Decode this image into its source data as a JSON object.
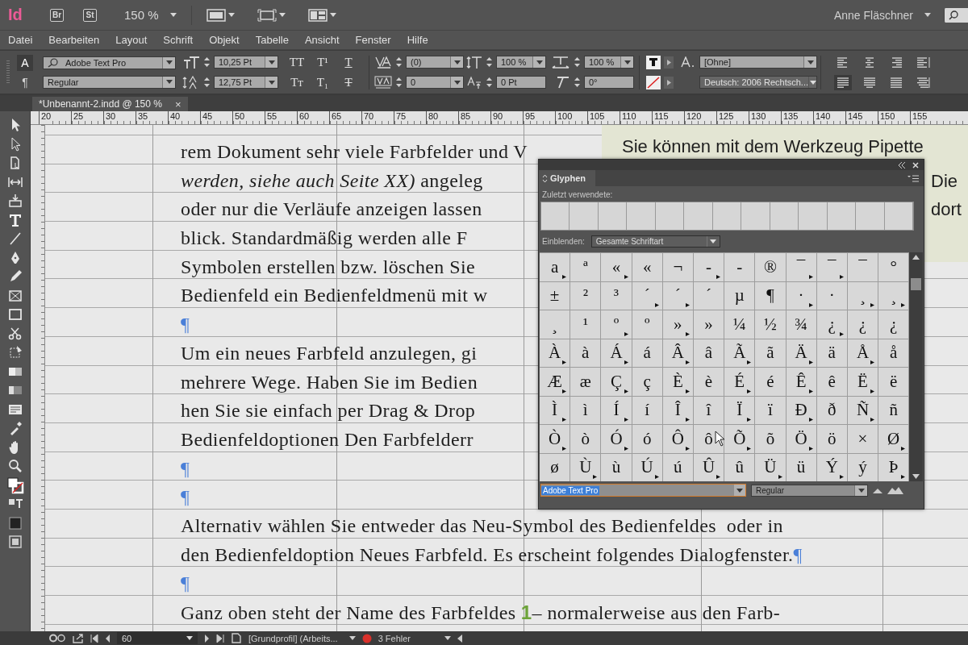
{
  "app_bar": {
    "logo": "Id",
    "bridge": "Br",
    "stock": "St",
    "zoom": "150 %",
    "user": "Anne Fläschner"
  },
  "menu": [
    "Datei",
    "Bearbeiten",
    "Layout",
    "Schrift",
    "Objekt",
    "Tabelle",
    "Ansicht",
    "Fenster",
    "Hilfe"
  ],
  "control_panel": {
    "modes": [
      {
        "label": "A",
        "selected": true
      },
      {
        "label": "¶",
        "selected": false
      }
    ],
    "font_family": "Adobe Text Pro",
    "font_style": "Regular",
    "font_size": "10,25 Pt",
    "leading": "12,75 Pt",
    "format_buttons": [
      {
        "label": "TT",
        "kind": "plain"
      },
      {
        "label": "T¹",
        "kind": "plain"
      },
      {
        "label": "T",
        "kind": "underline"
      },
      {
        "label": "Tт",
        "kind": "plain"
      },
      {
        "label": "T₁",
        "kind": "plain"
      },
      {
        "label": "T",
        "kind": "strike"
      }
    ],
    "kerning": "(0)",
    "tracking": "0",
    "vertical_scale": "100 %",
    "baseline_shift": "0 Pt",
    "horizontal_scale": "100 %",
    "skew": "0°",
    "char_style": "[Ohne]",
    "language": "Deutsch: 2006 Rechtsch...",
    "alignments": [
      {
        "kind": "left",
        "selected": false
      },
      {
        "kind": "center",
        "selected": false
      },
      {
        "kind": "right",
        "selected": false
      },
      {
        "kind": "spine",
        "selected": false
      },
      {
        "kind": "justify",
        "selected": true
      },
      {
        "kind": "justify-center",
        "selected": false
      },
      {
        "kind": "justify-all",
        "selected": false
      },
      {
        "kind": "spine-away",
        "selected": false
      }
    ]
  },
  "document_tab": {
    "title": "*Unbenannt-2.indd @ 150 %",
    "close": "×"
  },
  "ruler": [
    "20",
    "25",
    "30",
    "35",
    "40",
    "45",
    "50",
    "55",
    "60",
    "65",
    "70",
    "75",
    "80",
    "85",
    "90",
    "95",
    "100",
    "105",
    "110",
    "115",
    "120",
    "125",
    "130",
    "135",
    "140",
    "145",
    "150",
    "155"
  ],
  "document": {
    "lines": [
      [
        {
          "kind": "plain",
          "text": "rem Dokument sehr viele Farbfelder und V"
        }
      ],
      [
        {
          "kind": "italic",
          "text": "werden, siehe auch Seite XX)"
        },
        {
          "kind": "plain",
          "text": " angeleg"
        }
      ],
      [
        {
          "kind": "plain",
          "text": "oder nur die Verläufe anzeigen lassen"
        }
      ],
      [
        {
          "kind": "plain",
          "text": "blick. Standardmäßig werden alle F"
        }
      ],
      [
        {
          "kind": "plain",
          "text": "Symbolen erstellen bzw. löschen Sie"
        }
      ],
      [
        {
          "kind": "plain",
          "text": "Bedienfeld ein Bedienfeldmenü mit w"
        }
      ],
      [
        {
          "kind": "pilcrow",
          "text": "¶"
        }
      ],
      [
        {
          "kind": "plain",
          "text": "Um ein neues Farbfeld anzulegen, gi"
        }
      ],
      [
        {
          "kind": "plain",
          "text": "mehrere Wege. Haben Sie im Bedien"
        }
      ],
      [
        {
          "kind": "plain",
          "text": "hen Sie sie einfach per Drag & Drop"
        }
      ],
      [
        {
          "kind": "plain",
          "text": "Bedienfeldoptionen Den Farbfelderr"
        }
      ],
      [
        {
          "kind": "pilcrow",
          "text": "¶"
        }
      ],
      [
        {
          "kind": "pilcrow",
          "text": "¶"
        }
      ],
      [
        {
          "kind": "plain",
          "text": "Alternativ wählen Sie entweder das Neu-Symbol des Bedienfeldes  oder in"
        }
      ],
      [
        {
          "kind": "plain",
          "text": "den Bedienfeldoption Neues Farbfeld. Es erscheint folgendes Dialogfenster."
        },
        {
          "kind": "pilcrow",
          "text": "¶"
        }
      ],
      [
        {
          "kind": "pilcrow",
          "text": "¶"
        }
      ],
      [
        {
          "kind": "plain",
          "text": "Ganz oben steht der Name des Farbfeldes "
        },
        {
          "kind": "marker",
          "text": "1"
        },
        {
          "kind": "plain",
          "text": "– normalerweise aus den Farb-"
        }
      ]
    ],
    "tip_frame": {
      "first_line": "Sie können mit dem Werkzeug Pipette",
      "side_lines": [
        "Die",
        "dort"
      ]
    }
  },
  "glyph_panel": {
    "title": "Glyphen",
    "recent_label": "Zuletzt verwendete:",
    "show_label": "Einblenden:",
    "show_value": "Gesamte Schriftart",
    "font": "Adobe Text Pro",
    "style": "Regular",
    "rows": [
      [
        {
          "glyph": "a",
          "alternates": true
        },
        {
          "glyph": "ª",
          "alternates": false
        },
        {
          "glyph": "«",
          "alternates": true
        },
        {
          "glyph": "«",
          "alternates": false
        },
        {
          "glyph": "¬",
          "alternates": false
        },
        {
          "glyph": "-",
          "alternates": true
        },
        {
          "glyph": "-",
          "alternates": false
        },
        {
          "glyph": "®",
          "alternates": false
        },
        {
          "glyph": "¯",
          "alternates": true
        },
        {
          "glyph": "¯",
          "alternates": true
        },
        {
          "glyph": "¯",
          "alternates": false
        },
        {
          "glyph": "°",
          "alternates": false
        }
      ],
      [
        {
          "glyph": "±",
          "alternates": false
        },
        {
          "glyph": "²",
          "alternates": false
        },
        {
          "glyph": "³",
          "alternates": false
        },
        {
          "glyph": "´",
          "alternates": true
        },
        {
          "glyph": "´",
          "alternates": true
        },
        {
          "glyph": "´",
          "alternates": false
        },
        {
          "glyph": "µ",
          "alternates": false
        },
        {
          "glyph": "¶",
          "alternates": false
        },
        {
          "glyph": "·",
          "alternates": true
        },
        {
          "glyph": "·",
          "alternates": false
        },
        {
          "glyph": "¸",
          "alternates": true
        },
        {
          "glyph": "¸",
          "alternates": true
        }
      ],
      [
        {
          "glyph": "¸",
          "alternates": false
        },
        {
          "glyph": "¹",
          "alternates": false
        },
        {
          "glyph": "º",
          "alternates": true
        },
        {
          "glyph": "º",
          "alternates": false
        },
        {
          "glyph": "»",
          "alternates": true
        },
        {
          "glyph": "»",
          "alternates": false
        },
        {
          "glyph": "¼",
          "alternates": false
        },
        {
          "glyph": "½",
          "alternates": false
        },
        {
          "glyph": "¾",
          "alternates": false
        },
        {
          "glyph": "¿",
          "alternates": true
        },
        {
          "glyph": "¿",
          "alternates": false
        },
        {
          "glyph": "¿",
          "alternates": false
        }
      ],
      [
        {
          "glyph": "À",
          "alternates": true
        },
        {
          "glyph": "à",
          "alternates": false
        },
        {
          "glyph": "Á",
          "alternates": true
        },
        {
          "glyph": "á",
          "alternates": false
        },
        {
          "glyph": "Â",
          "alternates": true
        },
        {
          "glyph": "â",
          "alternates": false
        },
        {
          "glyph": "Ã",
          "alternates": true
        },
        {
          "glyph": "ã",
          "alternates": false
        },
        {
          "glyph": "Ä",
          "alternates": true
        },
        {
          "glyph": "ä",
          "alternates": false
        },
        {
          "glyph": "Å",
          "alternates": true
        },
        {
          "glyph": "å",
          "alternates": false
        }
      ],
      [
        {
          "glyph": "Æ",
          "alternates": true
        },
        {
          "glyph": "æ",
          "alternates": false
        },
        {
          "glyph": "Ç",
          "alternates": true
        },
        {
          "glyph": "ç",
          "alternates": false
        },
        {
          "glyph": "È",
          "alternates": true
        },
        {
          "glyph": "è",
          "alternates": false
        },
        {
          "glyph": "É",
          "alternates": true
        },
        {
          "glyph": "é",
          "alternates": false
        },
        {
          "glyph": "Ê",
          "alternates": true
        },
        {
          "glyph": "ê",
          "alternates": false
        },
        {
          "glyph": "Ë",
          "alternates": true
        },
        {
          "glyph": "ë",
          "alternates": false
        }
      ],
      [
        {
          "glyph": "Ì",
          "alternates": true
        },
        {
          "glyph": "ì",
          "alternates": false
        },
        {
          "glyph": "Í",
          "alternates": true
        },
        {
          "glyph": "í",
          "alternates": false
        },
        {
          "glyph": "Î",
          "alternates": true
        },
        {
          "glyph": "î",
          "alternates": false
        },
        {
          "glyph": "Ï",
          "alternates": true
        },
        {
          "glyph": "ï",
          "alternates": false
        },
        {
          "glyph": "Ð",
          "alternates": true
        },
        {
          "glyph": "ð",
          "alternates": false
        },
        {
          "glyph": "Ñ",
          "alternates": true
        },
        {
          "glyph": "ñ",
          "alternates": false
        }
      ],
      [
        {
          "glyph": "Ò",
          "alternates": true
        },
        {
          "glyph": "ò",
          "alternates": false
        },
        {
          "glyph": "Ó",
          "alternates": true
        },
        {
          "glyph": "ó",
          "alternates": false
        },
        {
          "glyph": "Ô",
          "alternates": true
        },
        {
          "glyph": "ô",
          "alternates": false
        },
        {
          "glyph": "Õ",
          "alternates": true
        },
        {
          "glyph": "õ",
          "alternates": false
        },
        {
          "glyph": "Ö",
          "alternates": true
        },
        {
          "glyph": "ö",
          "alternates": false
        },
        {
          "glyph": "×",
          "alternates": false
        },
        {
          "glyph": "Ø",
          "alternates": true
        }
      ],
      [
        {
          "glyph": "ø",
          "alternates": false
        },
        {
          "glyph": "Ù",
          "alternates": true
        },
        {
          "glyph": "ù",
          "alternates": false
        },
        {
          "glyph": "Ú",
          "alternates": true
        },
        {
          "glyph": "ú",
          "alternates": false
        },
        {
          "glyph": "Û",
          "alternates": true
        },
        {
          "glyph": "û",
          "alternates": false
        },
        {
          "glyph": "Ü",
          "alternates": true
        },
        {
          "glyph": "ü",
          "alternates": false
        },
        {
          "glyph": "Ý",
          "alternates": true
        },
        {
          "glyph": "ý",
          "alternates": false
        },
        {
          "glyph": "Þ",
          "alternates": true
        }
      ]
    ]
  },
  "status_bar": {
    "page": "60",
    "profile": "[Grundprofil] (Arbeits...",
    "errors": "3 Fehler"
  }
}
